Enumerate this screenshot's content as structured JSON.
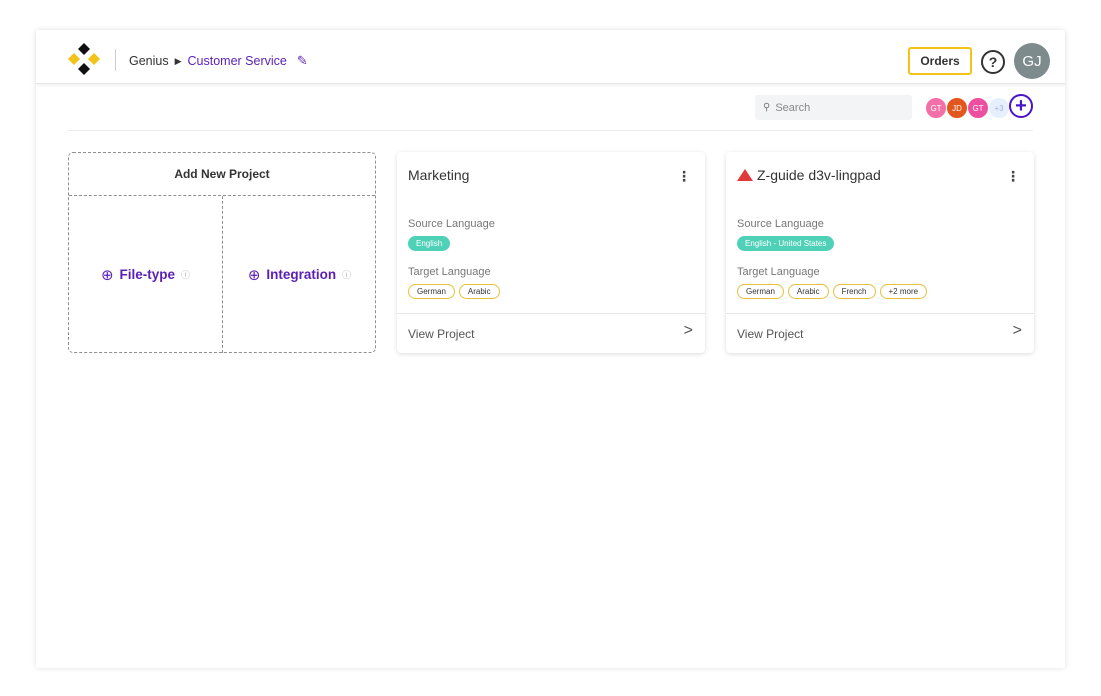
{
  "header": {
    "breadcrumb_root": "Genius",
    "breadcrumb_current": "Customer Service",
    "orders_label": "Orders",
    "help_symbol": "?",
    "user_initials": "GJ"
  },
  "toolbar": {
    "search_placeholder": "Search",
    "members": [
      {
        "initials": "GT",
        "color": "#f26fa8"
      },
      {
        "initials": "JD",
        "color": "#e2571d"
      },
      {
        "initials": "GT",
        "color": "#ec4fa0"
      },
      {
        "initials": "+3",
        "color": "#e8effc"
      }
    ],
    "add_member_symbol": "+"
  },
  "add_project": {
    "title": "Add New Project",
    "option_file_type": "File-type",
    "option_integration": "Integration"
  },
  "projects": [
    {
      "name": "Marketing",
      "source_label": "Source Language",
      "source_language": "English",
      "target_label": "Target Language",
      "targets": [
        "German",
        "Arabic"
      ],
      "view_label": "View Project"
    },
    {
      "name": "Z-guide d3v-lingpad",
      "source_label": "Source Language",
      "source_language": "English - United States",
      "target_label": "Target Language",
      "targets": [
        "German",
        "Arabic",
        "French",
        "+2 more"
      ],
      "view_label": "View Project"
    }
  ],
  "colors": {
    "accent_purple": "#5b1fb5",
    "accent_yellow": "#f3c318",
    "source_tag": "#4fd1b8"
  }
}
